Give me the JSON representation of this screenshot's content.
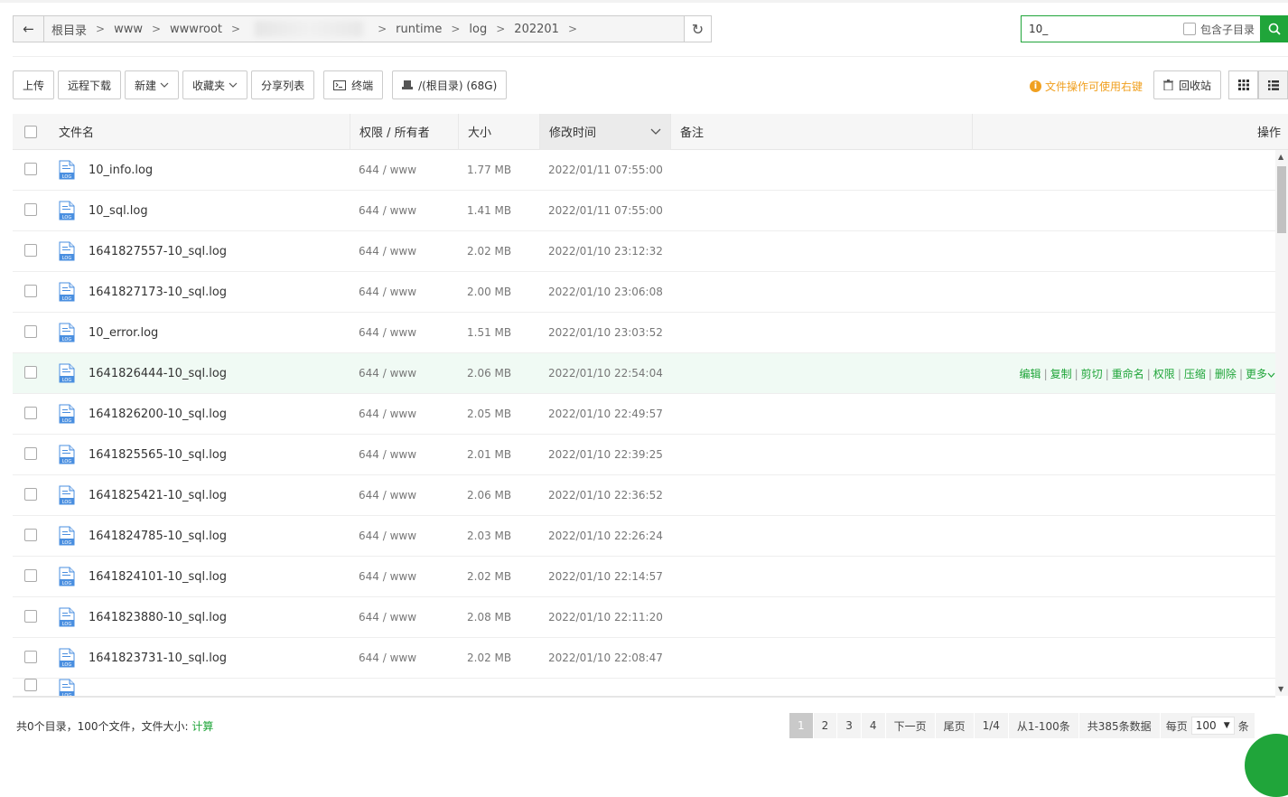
{
  "breadcrumb": {
    "items": [
      "根目录",
      "www",
      "wwwroot",
      "runtime",
      "log",
      "202201"
    ]
  },
  "search": {
    "value": "10_",
    "include_sub_label": "包含子目录"
  },
  "toolbar": {
    "upload": "上传",
    "remote_download": "远程下载",
    "new": "新建",
    "favorites": "收藏夹",
    "share_list": "分享列表",
    "terminal": "终端",
    "disk": "/(根目录) (68G)",
    "hint": "文件操作可使用右键",
    "recycle": "回收站"
  },
  "table": {
    "headers": {
      "name": "文件名",
      "perm": "权限 / 所有者",
      "size": "大小",
      "mtime": "修改时间",
      "note": "备注",
      "ops": "操作"
    },
    "rows": [
      {
        "name": "10_info.log",
        "perm": "644 / www",
        "size": "1.77 MB",
        "mtime": "2022/01/11 07:55:00"
      },
      {
        "name": "10_sql.log",
        "perm": "644 / www",
        "size": "1.41 MB",
        "mtime": "2022/01/11 07:55:00"
      },
      {
        "name": "1641827557-10_sql.log",
        "perm": "644 / www",
        "size": "2.02 MB",
        "mtime": "2022/01/10 23:12:32"
      },
      {
        "name": "1641827173-10_sql.log",
        "perm": "644 / www",
        "size": "2.00 MB",
        "mtime": "2022/01/10 23:06:08"
      },
      {
        "name": "10_error.log",
        "perm": "644 / www",
        "size": "1.51 MB",
        "mtime": "2022/01/10 23:03:52"
      },
      {
        "name": "1641826444-10_sql.log",
        "perm": "644 / www",
        "size": "2.06 MB",
        "mtime": "2022/01/10 22:54:04"
      },
      {
        "name": "1641826200-10_sql.log",
        "perm": "644 / www",
        "size": "2.05 MB",
        "mtime": "2022/01/10 22:49:57"
      },
      {
        "name": "1641825565-10_sql.log",
        "perm": "644 / www",
        "size": "2.01 MB",
        "mtime": "2022/01/10 22:39:25"
      },
      {
        "name": "1641825421-10_sql.log",
        "perm": "644 / www",
        "size": "2.06 MB",
        "mtime": "2022/01/10 22:36:52"
      },
      {
        "name": "1641824785-10_sql.log",
        "perm": "644 / www",
        "size": "2.03 MB",
        "mtime": "2022/01/10 22:26:24"
      },
      {
        "name": "1641824101-10_sql.log",
        "perm": "644 / www",
        "size": "2.02 MB",
        "mtime": "2022/01/10 22:14:57"
      },
      {
        "name": "1641823880-10_sql.log",
        "perm": "644 / www",
        "size": "2.08 MB",
        "mtime": "2022/01/10 22:11:20"
      },
      {
        "name": "1641823731-10_sql.log",
        "perm": "644 / www",
        "size": "2.02 MB",
        "mtime": "2022/01/10 22:08:47"
      }
    ],
    "row_actions": [
      "编辑",
      "复制",
      "剪切",
      "重命名",
      "权限",
      "压缩",
      "删除",
      "更多"
    ]
  },
  "footer": {
    "summary": "共0个目录，100个文件，文件大小:",
    "calc": "计算"
  },
  "pagination": {
    "pages": [
      "1",
      "2",
      "3",
      "4"
    ],
    "next": "下一页",
    "last": "尾页",
    "page_info": "1/4",
    "range": "从1-100条",
    "total": "共385条数据",
    "per_page_label": "每页",
    "per_page_value": "100",
    "per_page_unit": "条"
  },
  "colors": {
    "accent": "#20a53a",
    "hint": "#f0a020",
    "highlight_row": "#f0faf4"
  }
}
